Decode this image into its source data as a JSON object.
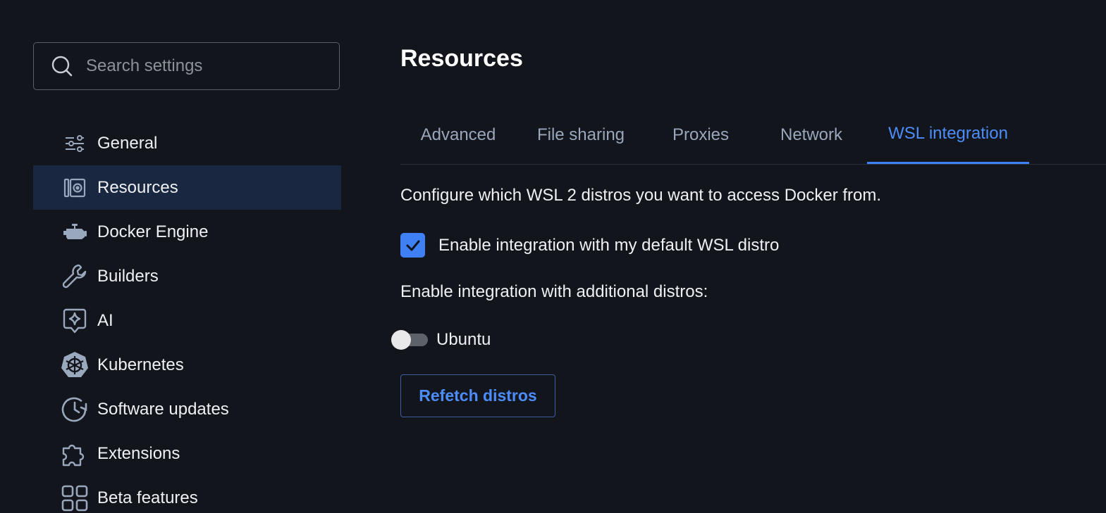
{
  "search": {
    "placeholder": "Search settings"
  },
  "sidebar": {
    "items": [
      {
        "label": "General",
        "icon": "sliders-icon"
      },
      {
        "label": "Resources",
        "icon": "resources-icon",
        "active": true
      },
      {
        "label": "Docker Engine",
        "icon": "engine-icon"
      },
      {
        "label": "Builders",
        "icon": "wrench-icon"
      },
      {
        "label": "AI",
        "icon": "ai-sparkle-icon"
      },
      {
        "label": "Kubernetes",
        "icon": "kubernetes-icon"
      },
      {
        "label": "Software updates",
        "icon": "clock-update-icon"
      },
      {
        "label": "Extensions",
        "icon": "puzzle-icon"
      },
      {
        "label": "Beta features",
        "icon": "grid-icon"
      }
    ]
  },
  "main": {
    "title": "Resources",
    "tabs": [
      {
        "label": "Advanced"
      },
      {
        "label": "File sharing"
      },
      {
        "label": "Proxies"
      },
      {
        "label": "Network"
      },
      {
        "label": "WSL integration",
        "active": true
      }
    ],
    "wsl": {
      "description": "Configure which WSL 2 distros you want to access Docker from.",
      "default_distro_label": "Enable integration with my default WSL distro",
      "default_distro_checked": true,
      "additional_label": "Enable integration with additional distros:",
      "distros": [
        {
          "name": "Ubuntu",
          "enabled": false
        }
      ],
      "refetch_label": "Refetch distros"
    }
  },
  "colors": {
    "background": "#12151b",
    "accent": "#3f82f7",
    "active_sidebar": "#1a2740",
    "icon": "#9aa8bd"
  }
}
